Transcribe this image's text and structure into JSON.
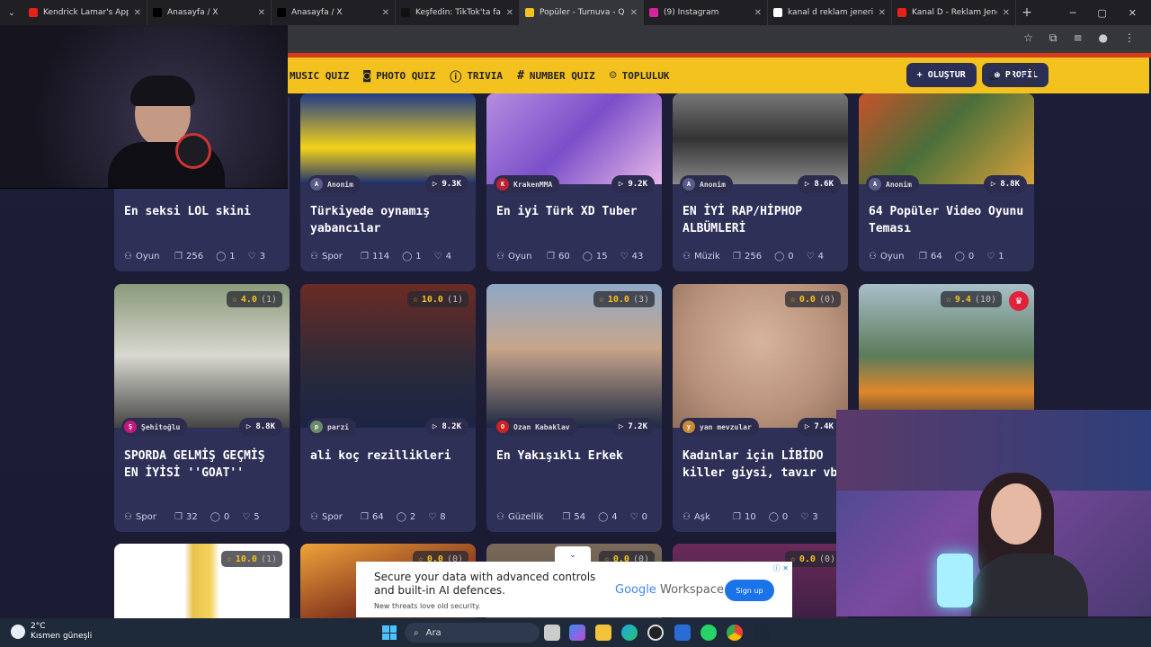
{
  "browser": {
    "tabs": [
      {
        "title": "Kendrick Lamar's Apple M",
        "color": "#e62117",
        "active": false
      },
      {
        "title": "Anasayfa / X",
        "color": "#000000",
        "active": false
      },
      {
        "title": "Anasayfa / X",
        "color": "#000000",
        "active": false
      },
      {
        "title": "Keşfedin: TikTok'ta favori",
        "color": "#111111",
        "active": false
      },
      {
        "title": "Popüler - Turnuva - Quiz",
        "color": "#f4c21f",
        "active": true
      },
      {
        "title": "(9) Instagram",
        "color": "#d6249f",
        "active": false
      },
      {
        "title": "kanal d reklam jeneriği - C",
        "color": "#ffffff",
        "active": false
      },
      {
        "title": "Kanal D - Reklam Jeneriği",
        "color": "#e62117",
        "active": false
      }
    ]
  },
  "site_nav": {
    "items": [
      {
        "label": "MUSIC QUIZ",
        "icon": "music-icon"
      },
      {
        "label": "PHOTO QUIZ",
        "icon": "camera-icon"
      },
      {
        "label": "TRIVIA",
        "icon": "question-bubble-icon"
      },
      {
        "label": "NUMBER QUIZ",
        "icon": "hash-icon"
      },
      {
        "label": "TOPLULUK",
        "icon": "users-icon"
      }
    ],
    "create_label": "OLUŞTUR",
    "profile_label": "PROFİL"
  },
  "cards_row1": [
    {
      "author": "Anonim",
      "plays": "9.3K",
      "title": "Türkiyede oynamış yabancılar",
      "category": "Spor",
      "questions": "114",
      "comments": "1",
      "likes": "4"
    },
    {
      "author": "KrakenMMA",
      "plays": "9.2K",
      "title": "En iyi Türk XD Tuber",
      "category": "Oyun",
      "questions": "60",
      "comments": "15",
      "likes": "43"
    },
    {
      "author": "Anonim",
      "plays": "8.6K",
      "title": "EN İYİ RAP/HİPHOP ALBÜMLERİ",
      "category": "Müzik",
      "questions": "256",
      "comments": "0",
      "likes": "4"
    },
    {
      "author": "Anonim",
      "plays": "8.8K",
      "title": "64 Popüler Video Oyunu Teması",
      "category": "Oyun",
      "questions": "64",
      "comments": "0",
      "likes": "1"
    }
  ],
  "card_row1_first": {
    "title": "En seksi LOL skini",
    "category": "Oyun",
    "questions": "256",
    "comments": "1",
    "likes": "3"
  },
  "cards_row2": [
    {
      "rating": "4.0",
      "rating_count": "(1)",
      "author": "Şehitoğlu",
      "plays": "8.8K",
      "title": "SPORDA GELMİŞ GEÇMİŞ EN İYİSİ ''GOAT''",
      "category": "Spor",
      "questions": "32",
      "comments": "0",
      "likes": "5"
    },
    {
      "rating": "10.0",
      "rating_count": "(1)",
      "author": "parzi",
      "plays": "8.2K",
      "title": "ali koç rezillikleri",
      "category": "Spor",
      "questions": "64",
      "comments": "2",
      "likes": "8"
    },
    {
      "rating": "10.0",
      "rating_count": "(3)",
      "author": "Ozan Kabaklav",
      "plays": "7.2K",
      "title": "En Yakışıklı Erkek",
      "category": "Güzellik",
      "questions": "54",
      "comments": "4",
      "likes": "0"
    },
    {
      "rating": "0.0",
      "rating_count": "(0)",
      "author": "yan mevzular",
      "plays": "7.4K",
      "title": "Kadınlar için LİBİDO killer giysi, tavır vb",
      "category": "Aşk",
      "questions": "10",
      "comments": "0",
      "likes": "3"
    },
    {
      "rating": "9.4",
      "rating_count": "(10)"
    }
  ],
  "cards_row3": [
    {
      "rating": "10.0",
      "rating_count": "(1)"
    },
    {
      "rating": "0.0",
      "rating_count": "(0)"
    },
    {
      "rating": "0.0",
      "rating_count": "(0)"
    },
    {
      "rating": "0.0",
      "rating_count": "(0)"
    }
  ],
  "ad": {
    "headline": "Secure your data with advanced controls and built-in AI defences.",
    "subline": "New threats love old security.",
    "brand_google": "Google",
    "brand_product": "Workspace",
    "cta": "Sign up"
  },
  "taskbar": {
    "temperature": "2°C",
    "weather": "Kısmen güneşli",
    "search_placeholder": "Ara"
  }
}
